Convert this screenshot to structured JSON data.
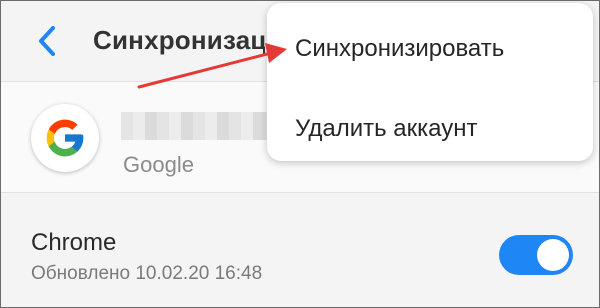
{
  "header": {
    "title": "Синхронизация",
    "back_icon": "chevron-left-icon",
    "accent": "#1f86f5"
  },
  "account": {
    "type_label": "Google",
    "logo_icon": "google-logo-icon"
  },
  "sync_item": {
    "name": "Chrome",
    "updated": "Обновлено 10.02.20 16:48",
    "enabled": true,
    "toggle_color": "#1f86f5"
  },
  "menu": {
    "items": [
      {
        "label": "Синхронизировать"
      },
      {
        "label": "Удалить аккаунт"
      }
    ]
  },
  "annotation": {
    "arrow_color": "#e53935"
  }
}
